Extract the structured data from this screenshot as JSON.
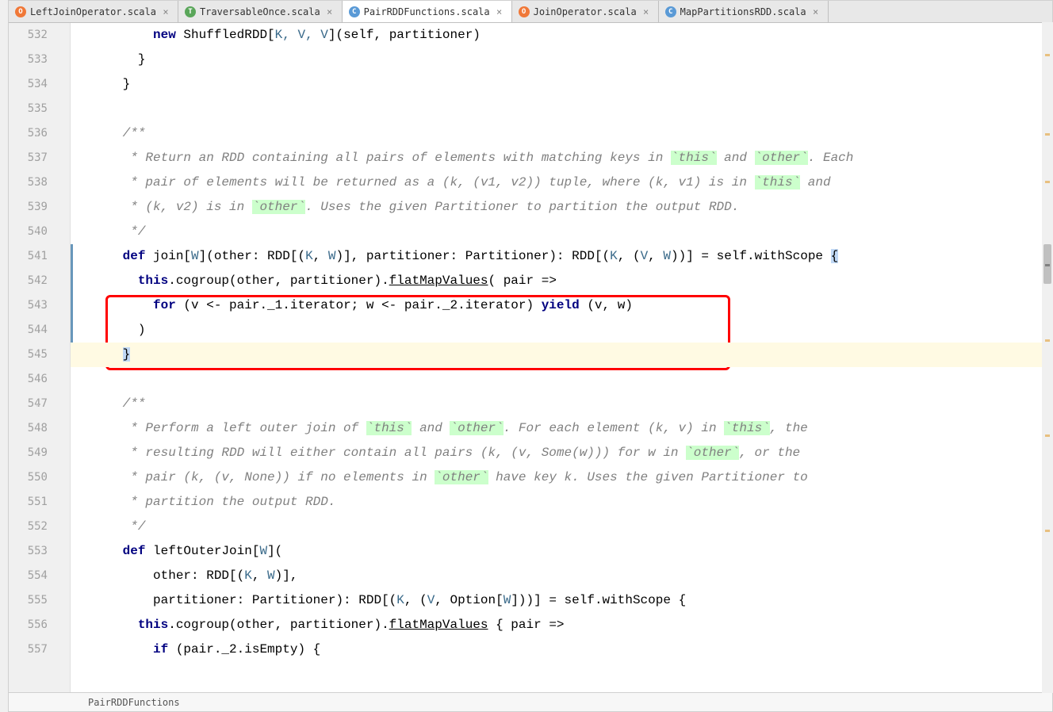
{
  "tabs": [
    {
      "icon": "O",
      "iconClass": "icon-orange",
      "label": "LeftJoinOperator.scala",
      "active": false
    },
    {
      "icon": "T",
      "iconClass": "icon-green",
      "label": "TraversableOnce.scala",
      "active": false
    },
    {
      "icon": "C",
      "iconClass": "icon-blue",
      "label": "PairRDDFunctions.scala",
      "active": true
    },
    {
      "icon": "O",
      "iconClass": "icon-orange",
      "label": "JoinOperator.scala",
      "active": false
    },
    {
      "icon": "C",
      "iconClass": "icon-blue",
      "label": "MapPartitionsRDD.scala",
      "active": false
    }
  ],
  "gutter": {
    "lines": [
      "532",
      "533",
      "534",
      "535",
      "536",
      "537",
      "538",
      "539",
      "540",
      "541",
      "542",
      "543",
      "544",
      "545",
      "546",
      "547",
      "548",
      "549",
      "550",
      "551",
      "552",
      "553",
      "554",
      "555",
      "556",
      "557",
      ""
    ]
  },
  "code": {
    "l532_indent": "          ",
    "l532_kw": "new",
    "l532_rest": " ShuffledRDD[",
    "l532_types": "K, V, V",
    "l532_end": "](self, partitioner)",
    "l533": "        }",
    "l534": "      }",
    "l535": "",
    "l536": "      /**",
    "l537_a": "       * Return an RDD containing all pairs of elements with matching keys in ",
    "l537_b": "`this`",
    "l537_c": " and ",
    "l537_d": "`other`",
    "l537_e": ". Each",
    "l538_a": "       * pair of elements will be returned as a (k, (v1, v2)) tuple, where (k, v1) is in ",
    "l538_b": "`this`",
    "l538_c": " and",
    "l539_a": "       * (k, v2) is in ",
    "l539_b": "`other`",
    "l539_c": ". Uses the given Partitioner to partition the output RDD.",
    "l540": "       */",
    "l541_indent": "      ",
    "l541_def": "def",
    "l541_a": " join[",
    "l541_W": "W",
    "l541_b": "](other: RDD[(",
    "l541_K": "K",
    "l541_c": ", ",
    "l541_W2": "W",
    "l541_d": ")], partitioner: Partitioner): RDD[(",
    "l541_K2": "K",
    "l541_e": ", (",
    "l541_V": "V",
    "l541_f": ", ",
    "l541_W3": "W",
    "l541_g": "))] = self.withScope ",
    "l541_brace": "{",
    "l542_indent": "        ",
    "l542_this": "this",
    "l542_a": ".cogroup(other, partitioner).",
    "l542_flat": "flatMapValues",
    "l542_b": "( pair =>",
    "l543_indent": "          ",
    "l543_for": "for",
    "l543_a": " (v <- pair._1.iterator; w <- pair._2.iterator) ",
    "l543_yield": "yield",
    "l543_b": " (v, w)",
    "l544": "        )",
    "l545_indent": "      ",
    "l545_brace": "}",
    "l546": "",
    "l547": "      /**",
    "l548_a": "       * Perform a left outer join of ",
    "l548_b": "`this`",
    "l548_c": " and ",
    "l548_d": "`other`",
    "l548_e": ". For each element (k, v) in ",
    "l548_f": "`this`",
    "l548_g": ", the",
    "l549_a": "       * resulting RDD will either contain all pairs (k, (v, Some(w))) for w in ",
    "l549_b": "`other`",
    "l549_c": ", or the",
    "l550_a": "       * pair (k, (v, None)) if no elements in ",
    "l550_b": "`other`",
    "l550_c": " have key k. Uses the given Partitioner to",
    "l551": "       * partition the output RDD.",
    "l552": "       */",
    "l553_indent": "      ",
    "l553_def": "def",
    "l553_a": " leftOuterJoin[",
    "l553_W": "W",
    "l553_b": "](",
    "l554_a": "          other: RDD[(",
    "l554_K": "K",
    "l554_b": ", ",
    "l554_W": "W",
    "l554_c": ")],",
    "l555_a": "          partitioner: Partitioner): RDD[(",
    "l555_K": "K",
    "l555_b": ", (",
    "l555_V": "V",
    "l555_c": ", Option[",
    "l555_W": "W",
    "l555_d": "]))] = self.withScope {",
    "l556_indent": "        ",
    "l556_this": "this",
    "l556_a": ".cogroup(other, partitioner).",
    "l556_flat": "flatMapValues",
    "l556_b": " { pair =>",
    "l557_indent": "          ",
    "l557_if": "if",
    "l557_a": " (pair._2.isEmpty) {"
  },
  "breadcrumb": "PairRDDFunctions",
  "leftEdge": [
    "",
    "",
    "",
    "",
    "",
    "o",
    "",
    "<",
    "",
    "",
    "r",
    ""
  ]
}
